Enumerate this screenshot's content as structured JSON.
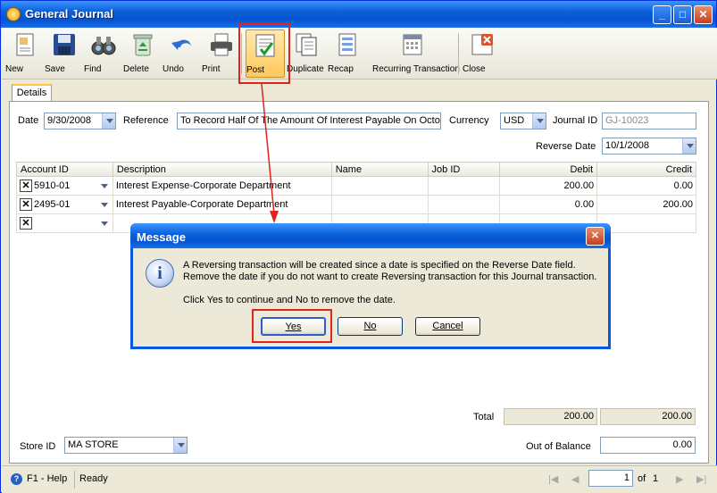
{
  "window": {
    "title": "General Journal"
  },
  "toolbar": {
    "new": "New",
    "save": "Save",
    "find": "Find",
    "delete": "Delete",
    "undo": "Undo",
    "print": "Print",
    "post": "Post",
    "duplicate": "Duplicate",
    "recap": "Recap",
    "recurring": "Recurring Transaction",
    "close": "Close"
  },
  "tab": {
    "details": "Details"
  },
  "form": {
    "date_label": "Date",
    "date": "9/30/2008",
    "reference_label": "Reference",
    "reference": "To Record Half Of The Amount Of Interest Payable On Octob",
    "currency_label": "Currency",
    "currency": "USD",
    "journal_id_label": "Journal ID",
    "journal_id": "GJ-10023",
    "reverse_date_label": "Reverse Date",
    "reverse_date": "10/1/2008"
  },
  "grid": {
    "headers": {
      "account": "Account ID",
      "description": "Description",
      "name": "Name",
      "job": "Job ID",
      "debit": "Debit",
      "credit": "Credit"
    },
    "rows": [
      {
        "account": "5910-01",
        "description": "Interest Expense-Corporate Department",
        "name": "",
        "job": "",
        "debit": "200.00",
        "credit": "0.00"
      },
      {
        "account": "2495-01",
        "description": "Interest Payable-Corporate Department",
        "name": "",
        "job": "",
        "debit": "0.00",
        "credit": "200.00"
      }
    ],
    "total_label": "Total",
    "total_debit": "200.00",
    "total_credit": "200.00"
  },
  "footer": {
    "store_label": "Store ID",
    "store": "MA STORE",
    "oob_label": "Out of Balance",
    "oob": "0.00"
  },
  "statusbar": {
    "help": "F1 - Help",
    "status": "Ready",
    "page": "1",
    "of": "of",
    "pages": "1"
  },
  "dialog": {
    "title": "Message",
    "line1": "A Reversing transaction will be created since a date is specified on the Reverse Date field.",
    "line2": "Remove the date if you do not want to create Reversing transaction for this Journal transaction.",
    "line3": "Click Yes to continue and No to remove the date.",
    "yes": "Yes",
    "no": "No",
    "cancel": "Cancel"
  },
  "colors": {
    "highlight": "#e0231b",
    "titlebar": "#0a5fd8"
  }
}
